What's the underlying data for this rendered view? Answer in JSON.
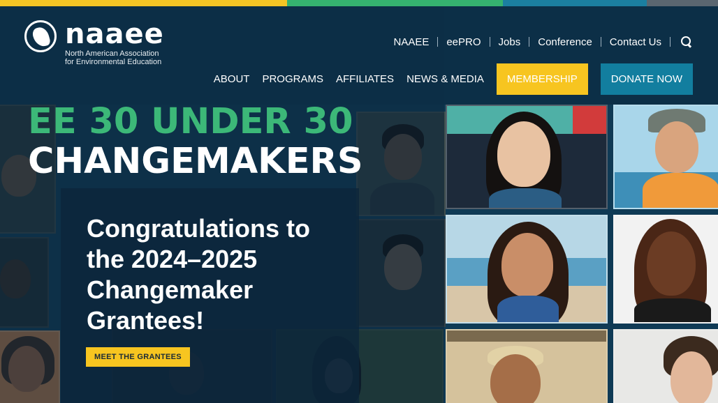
{
  "stripe": {
    "colors": [
      "#f4c525",
      "#35b26f",
      "#1b7fa0",
      "#5a6670"
    ]
  },
  "logo": {
    "icon": "globe-north-america-icon",
    "word": "naaee",
    "subtitle_line1": "North American Association",
    "subtitle_line2": "for Environmental Education"
  },
  "utility_nav": {
    "items": [
      "NAAEE",
      "eePRO",
      "Jobs",
      "Conference",
      "Contact Us"
    ],
    "search_icon": "search-icon"
  },
  "main_nav": {
    "items": [
      "ABOUT",
      "PROGRAMS",
      "AFFILIATES",
      "NEWS & MEDIA"
    ],
    "membership": "MEMBERSHIP",
    "donate": "DONATE NOW"
  },
  "hero": {
    "line1": "EE 30 UNDER 30",
    "line2": "CHANGEMAKERS",
    "callout_heading": "Congratulations to the 2024–2025 Changemaker Grantees!",
    "cta": "MEET THE GRANTEES"
  },
  "colors": {
    "accent_yellow": "#f7c520",
    "accent_teal": "#127e9f",
    "accent_green": "#3cb878",
    "header_bg": "#0d2e46"
  }
}
